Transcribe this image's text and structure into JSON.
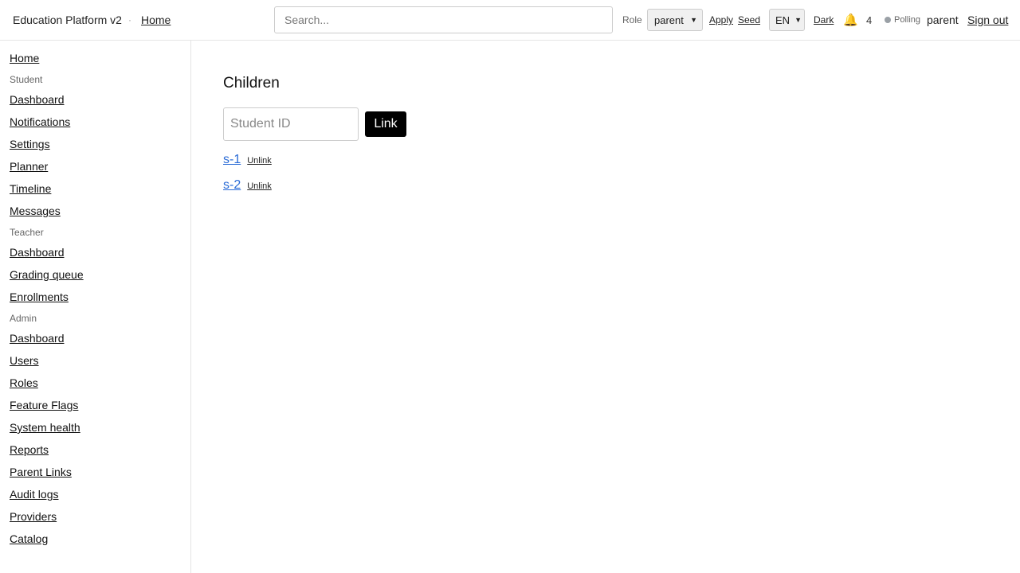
{
  "header": {
    "app_title": "Education Platform v2",
    "separator": "·",
    "home_label": "Home",
    "search_placeholder": "Search...",
    "role_label": "Role",
    "role_selected": "parent",
    "apply_label": "Apply",
    "seed_label": "Seed",
    "lang_selected": "EN",
    "dark_label": "Dark",
    "bell_icon": "bell-icon",
    "notification_count": "4",
    "poll_status": "Polling",
    "poll_dot_color": "#9aa0a6",
    "user_name": "parent",
    "signout_label": "Sign out"
  },
  "sidebar": {
    "home": "Home",
    "student": {
      "title": "Student",
      "items": [
        "Dashboard",
        "Notifications",
        "Settings",
        "Planner",
        "Timeline",
        "Messages"
      ]
    },
    "teacher": {
      "title": "Teacher",
      "items": [
        "Dashboard",
        "Grading queue",
        "Enrollments"
      ]
    },
    "admin": {
      "title": "Admin",
      "items": [
        "Dashboard",
        "Users",
        "Roles",
        "Feature Flags",
        "System health",
        "Reports",
        "Parent Links",
        "Audit logs",
        "Providers",
        "Catalog"
      ]
    }
  },
  "main": {
    "title": "Children",
    "student_id_placeholder": "Student ID",
    "link_button_label": "Link",
    "children": [
      {
        "id": "s-1",
        "unlink_label": "Unlink"
      },
      {
        "id": "s-2",
        "unlink_label": "Unlink"
      }
    ],
    "accent_color": "#2a6bd6"
  }
}
